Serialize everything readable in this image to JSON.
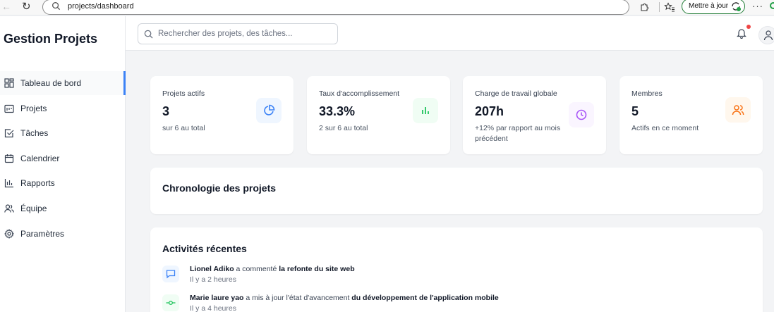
{
  "browser": {
    "url": "projects/dashboard",
    "update_label": "Mettre à jour",
    "more_label": "···"
  },
  "sidebar": {
    "title": "Gestion Projets",
    "items": [
      {
        "label": "Tableau de bord",
        "icon": "grid-icon",
        "active": true
      },
      {
        "label": "Projets",
        "icon": "folder-icon",
        "active": false
      },
      {
        "label": "Tâches",
        "icon": "checkbox-icon",
        "active": false
      },
      {
        "label": "Calendrier",
        "icon": "calendar-icon",
        "active": false
      },
      {
        "label": "Rapports",
        "icon": "bar-chart-icon",
        "active": false
      },
      {
        "label": "Équipe",
        "icon": "users-icon",
        "active": false
      },
      {
        "label": "Paramètres",
        "icon": "gear-icon",
        "active": false
      }
    ]
  },
  "header": {
    "search_placeholder": "Rechercher des projets, des tâches..."
  },
  "stats": [
    {
      "title": "Projets actifs",
      "value": "3",
      "sub": "sur 6 au total",
      "icon": "pie-chart-icon",
      "color": "#3b82f6",
      "bg": "#eff6ff"
    },
    {
      "title": "Taux d'accomplissement",
      "value": "33.3%",
      "sub": "2 sur 6 au total",
      "icon": "bar-chart-icon",
      "color": "#22c55e",
      "bg": "#f0fdf4"
    },
    {
      "title": "Charge de travail globale",
      "value": "207h",
      "sub": "+12% par rapport au mois précédent",
      "icon": "clock-icon",
      "color": "#a855f7",
      "bg": "#faf5ff"
    },
    {
      "title": "Membres",
      "value": "5",
      "sub": "Actifs en ce moment",
      "icon": "users-icon",
      "color": "#f97316",
      "bg": "#fff7ed"
    }
  ],
  "timeline": {
    "title": "Chronologie des projets"
  },
  "activities": {
    "title": "Activités récentes",
    "items": [
      {
        "user": "Lionel Adiko",
        "action": " a commenté ",
        "target": "la refonte du site web",
        "time": "Il y a 2 heures",
        "icon": "message-icon",
        "color": "#3b82f6",
        "bg": "#eff6ff"
      },
      {
        "user": "Marie laure yao",
        "action": " a mis à jour l'état d'avancement ",
        "target": "du développement de l'application mobile",
        "time": "Il y a 4 heures",
        "icon": "commit-icon",
        "color": "#22c55e",
        "bg": "#f0fdf4"
      }
    ]
  }
}
